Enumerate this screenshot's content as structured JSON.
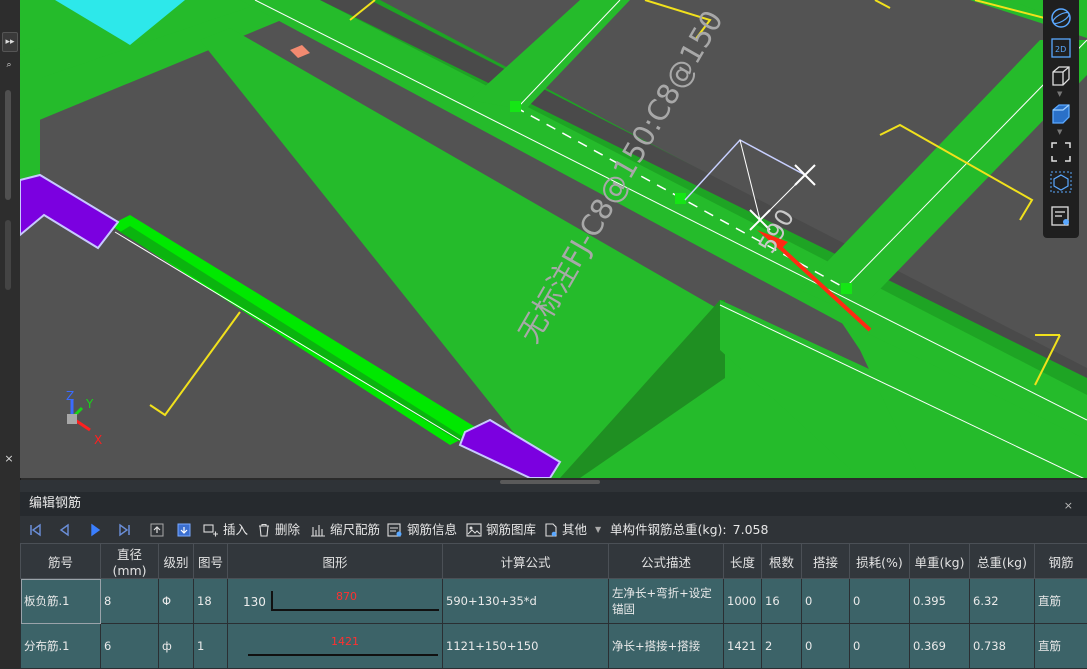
{
  "viewport": {
    "annotation": "无标注FJ-C8@150:C8@150",
    "dimension": "590",
    "axis": {
      "z": "Z",
      "y": "Y",
      "x": "X"
    },
    "colors": {
      "background": "#535353",
      "beam": "#25bb2b",
      "strip": "#00e800",
      "purple": "#7b00e0",
      "cyan": "#2de8ea",
      "rebar": "#f1e11c"
    }
  },
  "right_toolbar": {
    "icons": [
      "sphere-icon",
      "2d-icon",
      "cube-outline-icon",
      "cube-filled-icon",
      "fullscreen-icon",
      "box-select-icon",
      "properties-icon"
    ],
    "label_2d": "2D"
  },
  "panel": {
    "title": "编辑钢筋",
    "close": "×",
    "toolbar": {
      "insert": "插入",
      "delete": "删除",
      "scale": "缩尺配筋",
      "info": "钢筋信息",
      "library": "钢筋图库",
      "other": "其他",
      "total_label": "单构件钢筋总重(kg):",
      "total_value": "7.058"
    },
    "headers": [
      "筋号",
      "直径(mm)",
      "级别",
      "图号",
      "图形",
      "计算公式",
      "公式描述",
      "长度",
      "根数",
      "搭接",
      "损耗(%)",
      "单重(kg)",
      "总重(kg)",
      "钢筋"
    ],
    "rows": [
      {
        "index": "1",
        "name": "板负筋.1",
        "diameter": "8",
        "grade": "Φ",
        "fig": "18",
        "shape_left": "130",
        "shape_main": "870",
        "formula": "590+130+35*d",
        "desc": "左净长+弯折+设定锚固",
        "length": "1000",
        "count": "16",
        "lap": "0",
        "loss": "0",
        "unit_weight": "0.395",
        "total_weight": "6.32",
        "type": "直筋"
      },
      {
        "index": "2",
        "name": "分布筋.1",
        "diameter": "6",
        "grade": "ф",
        "fig": "1",
        "shape_left": "",
        "shape_main": "1421",
        "formula": "1121+150+150",
        "desc": "净长+搭接+搭接",
        "length": "1421",
        "count": "2",
        "lap": "0",
        "loss": "0",
        "unit_weight": "0.369",
        "total_weight": "0.738",
        "type": "直筋"
      }
    ]
  }
}
